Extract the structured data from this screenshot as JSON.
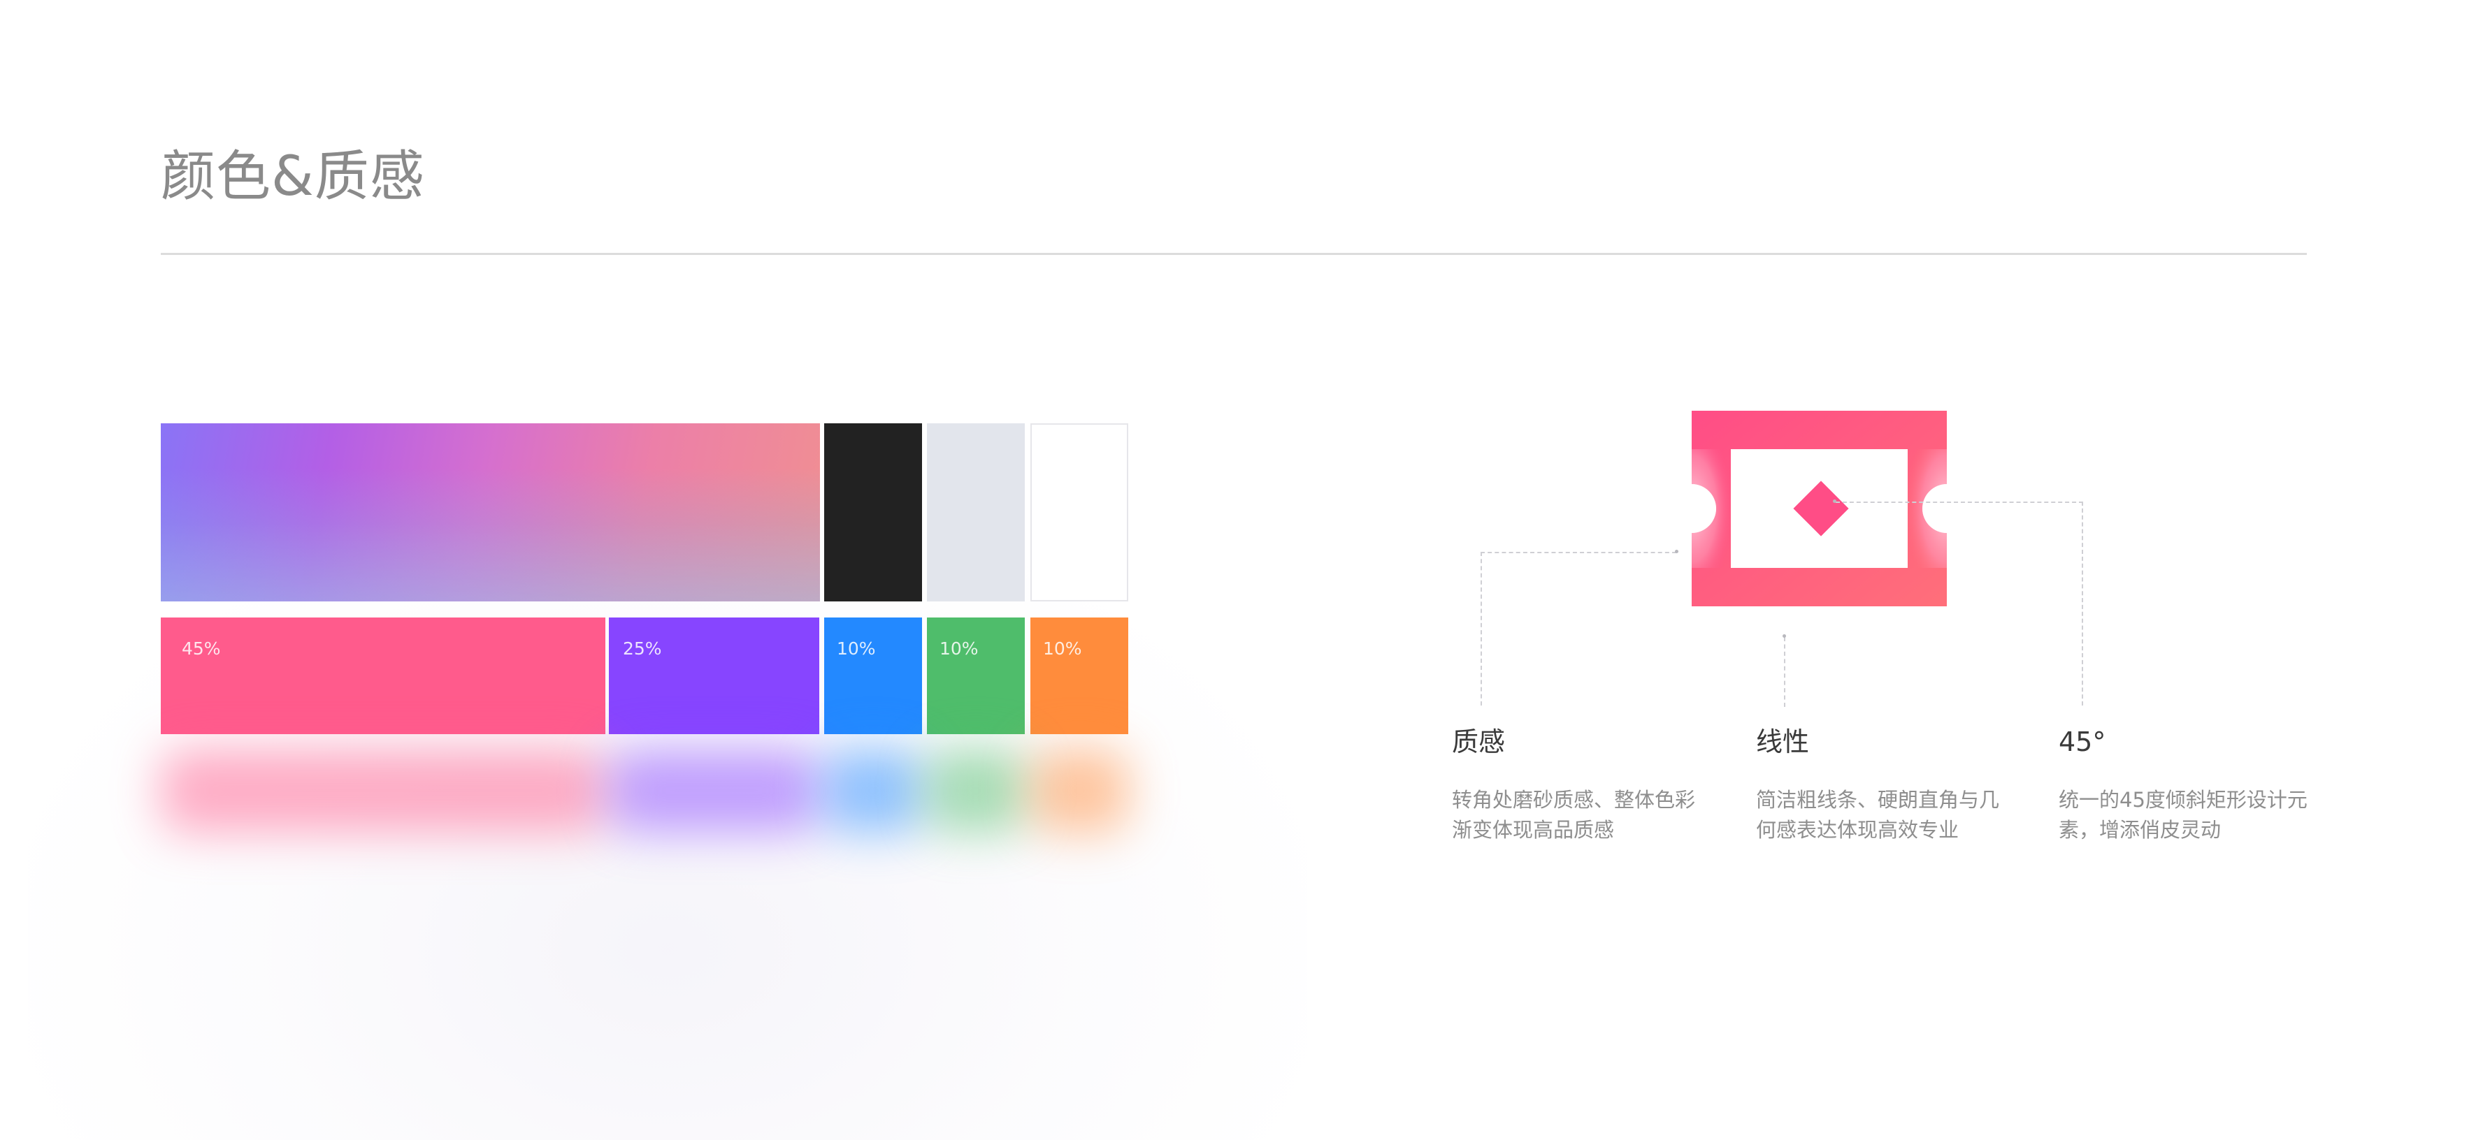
{
  "page": {
    "title": "颜色&质感"
  },
  "palette": {
    "base_swatches": [
      {
        "name": "gradient",
        "colors": [
          "#8a74f6",
          "#b35fe6",
          "#ec7fa8",
          "#f08f92"
        ]
      },
      {
        "name": "black",
        "color": "#222222"
      },
      {
        "name": "gray",
        "color": "#e2e5ec"
      },
      {
        "name": "white",
        "color": "#ffffff"
      }
    ],
    "ratio_swatches": [
      {
        "label": "45%",
        "color": "#ff5b8c",
        "ratio": 0.45
      },
      {
        "label": "25%",
        "color": "#8745ff",
        "ratio": 0.25
      },
      {
        "label": "10%",
        "color": "#2389ff",
        "ratio": 0.1
      },
      {
        "label": "10%",
        "color": "#4fbd6b",
        "ratio": 0.1
      },
      {
        "label": "10%",
        "color": "#ff8c3c",
        "ratio": 0.1
      }
    ]
  },
  "logo": {
    "icon": "ticket-diamond-icon",
    "colors": {
      "frame_start": "#ff4d86",
      "frame_end": "#ff6f7a",
      "diamond": "#ff4d86",
      "inner": "#ffffff"
    }
  },
  "features": [
    {
      "title": "质感",
      "description": "转角处磨砂质感、整体色彩渐变体现高品质感"
    },
    {
      "title": "线性",
      "description": "简洁粗线条、硬朗直角与几何感表达体现高效专业"
    },
    {
      "title": "45°",
      "description": "统一的45度倾斜矩形设计元素，增添俏皮灵动"
    }
  ]
}
